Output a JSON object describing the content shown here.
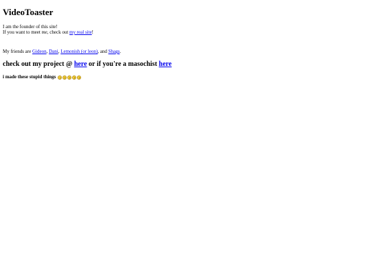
{
  "header": {
    "title": "VideoToaster"
  },
  "intro": {
    "line1": "I am the founder of this site!",
    "line2_prefix": "If you want to meet ",
    "line2_em": "me",
    "line2_mid": ", check out ",
    "line2_link": "my real site",
    "line2_suffix": "!"
  },
  "friends": {
    "prefix": "My friends are ",
    "items": [
      "Gideon",
      "Dani",
      "Lemonish (or leon)",
      "Shags"
    ],
    "sep1": ", ",
    "sep2": ", ",
    "sep3": ", and ",
    "suffix": "."
  },
  "project": {
    "prefix": "check out my project @ ",
    "link1": "here",
    "mid": " or if you're a masochist ",
    "link2": "here"
  },
  "emojis": {
    "label": "i made these stupid things",
    "icons": [
      "emoji-smug",
      "emoji-smirk",
      "emoji-meh",
      "emoji-unamused",
      "emoji-annoyed"
    ]
  },
  "colors": {
    "link": "#0000ee",
    "text": "#000000",
    "background": "#ffffff",
    "emoji": "#f5d23a"
  }
}
